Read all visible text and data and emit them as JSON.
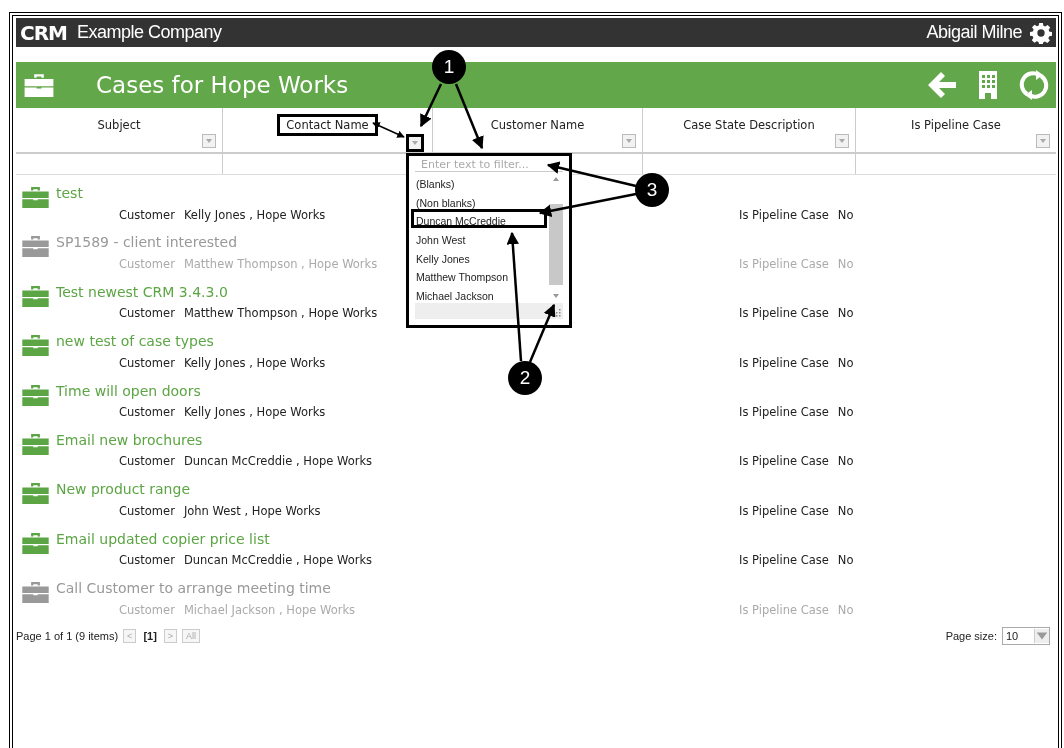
{
  "header": {
    "logo": "CRM",
    "company": "Example Company",
    "user": "Abigail Milne"
  },
  "title": "Cases for Hope Works",
  "columns": [
    {
      "label": "Subject"
    },
    {
      "label": "Contact Name"
    },
    {
      "label": "Customer Name"
    },
    {
      "label": "Case State Description"
    },
    {
      "label": "Is Pipeline Case"
    }
  ],
  "filter_popup": {
    "placeholder": "Enter text to filter...",
    "items": [
      {
        "label": "(Blanks)",
        "highlighted": false
      },
      {
        "label": "(Non blanks)",
        "highlighted": false
      },
      {
        "label": "Duncan McCreddie",
        "highlighted": true
      },
      {
        "label": "John West",
        "highlighted": false
      },
      {
        "label": "Kelly Jones",
        "highlighted": false
      },
      {
        "label": "Matthew Thompson",
        "highlighted": false
      },
      {
        "label": "Michael Jackson",
        "highlighted": false
      }
    ]
  },
  "rows": [
    {
      "subject": "test",
      "label": "Customer",
      "contact": "Kelly Jones , Hope Works",
      "pipeline_label": "Is Pipeline Case",
      "pipeline": "No",
      "disabled": false
    },
    {
      "subject": "SP1589 - client interested",
      "label": "Customer",
      "contact": "Matthew Thompson , Hope Works",
      "pipeline_label": "Is Pipeline Case",
      "pipeline": "No",
      "disabled": true
    },
    {
      "subject": "Test newest CRM 3.4.3.0",
      "label": "Customer",
      "contact": "Matthew Thompson , Hope Works",
      "pipeline_label": "Is Pipeline Case",
      "pipeline": "No",
      "disabled": false
    },
    {
      "subject": "new test of case types",
      "label": "Customer",
      "contact": "Kelly Jones , Hope Works",
      "pipeline_label": "Is Pipeline Case",
      "pipeline": "No",
      "disabled": false
    },
    {
      "subject": "Time will open doors",
      "label": "Customer",
      "contact": "Kelly Jones , Hope Works",
      "pipeline_label": "Is Pipeline Case",
      "pipeline": "No",
      "disabled": false
    },
    {
      "subject": "Email new brochures",
      "label": "Customer",
      "contact": "Duncan McCreddie , Hope Works",
      "pipeline_label": "Is Pipeline Case",
      "pipeline": "No",
      "disabled": false
    },
    {
      "subject": "New product range",
      "label": "Customer",
      "contact": "John West , Hope Works",
      "pipeline_label": "Is Pipeline Case",
      "pipeline": "No",
      "disabled": false
    },
    {
      "subject": "Email updated copier price list",
      "label": "Customer",
      "contact": "Duncan McCreddie , Hope Works",
      "pipeline_label": "Is Pipeline Case",
      "pipeline": "No",
      "disabled": false
    },
    {
      "subject": "Call Customer to arrange meeting time",
      "label": "Customer",
      "contact": "Michael Jackson , Hope Works",
      "pipeline_label": "Is Pipeline Case",
      "pipeline": "No",
      "disabled": true
    }
  ],
  "pager": {
    "summary": "Page 1 of 1 (9 items)",
    "prev": "<",
    "pages": [
      {
        "label": "[1]",
        "selected": true
      }
    ],
    "next": ">",
    "all": "All",
    "page_size_label": "Page size:",
    "page_size": "10"
  },
  "callouts": [
    "1",
    "2",
    "3"
  ]
}
